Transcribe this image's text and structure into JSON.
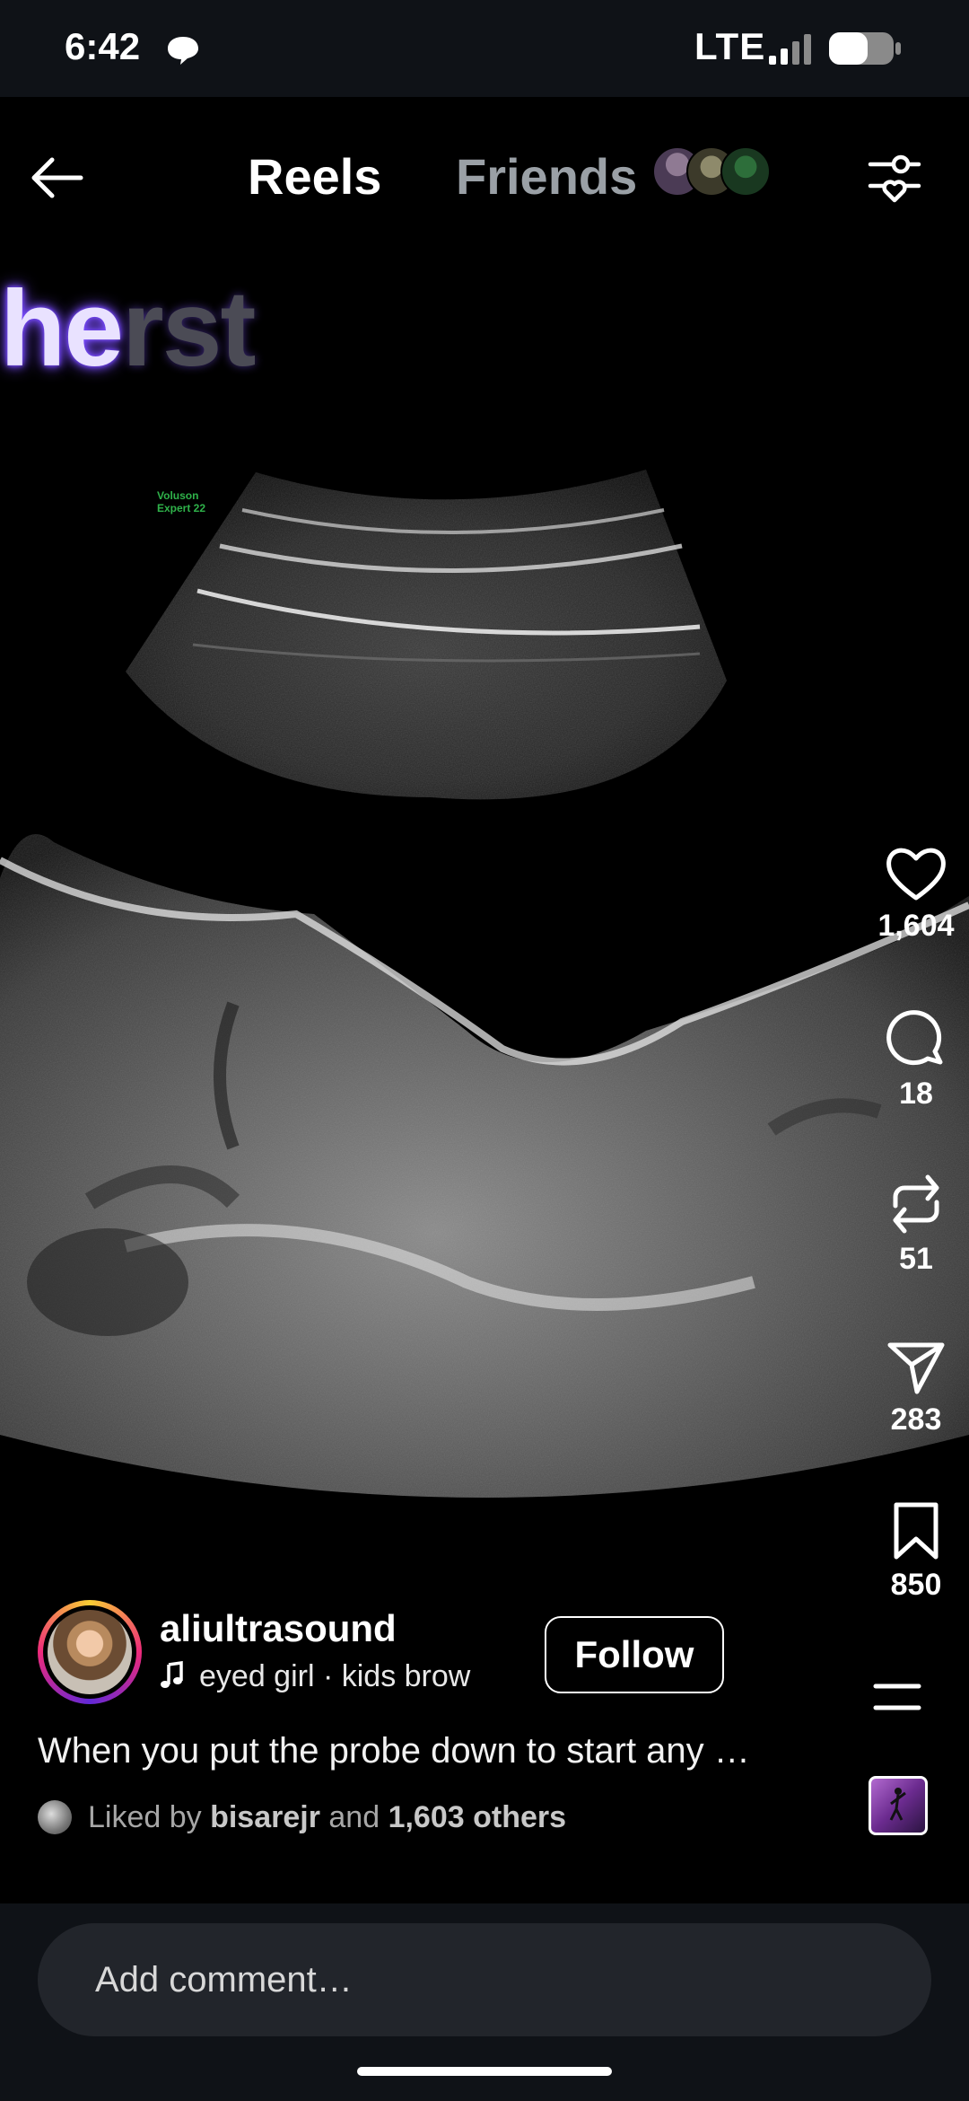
{
  "status_bar": {
    "time": "6:42",
    "network": "LTE",
    "battery_level": 0.6
  },
  "header": {
    "tab_active": "Reels",
    "tab_inactive": "Friends"
  },
  "video": {
    "caption_highlight": "he",
    "caption_rest": "rst",
    "caption_behind": "first",
    "probe_label": "Voluson\nExpert 22"
  },
  "actions": {
    "likes": "1,604",
    "comments": "18",
    "reposts": "51",
    "shares": "283",
    "saves": "850"
  },
  "post": {
    "username": "aliultrasound",
    "music": "eyed girl · kids   brow",
    "follow_label": "Follow",
    "description": "When you put the probe down to start any …",
    "liked_prefix": "Liked by ",
    "liked_user": "bisarejr",
    "liked_and": " and ",
    "liked_others": "1,603 others"
  },
  "comment_bar": {
    "placeholder": "Add comment…"
  },
  "colors": {
    "accent_glow": "#7b4dff",
    "background": "#000000",
    "inactive_tab": "#9aa0a6"
  }
}
